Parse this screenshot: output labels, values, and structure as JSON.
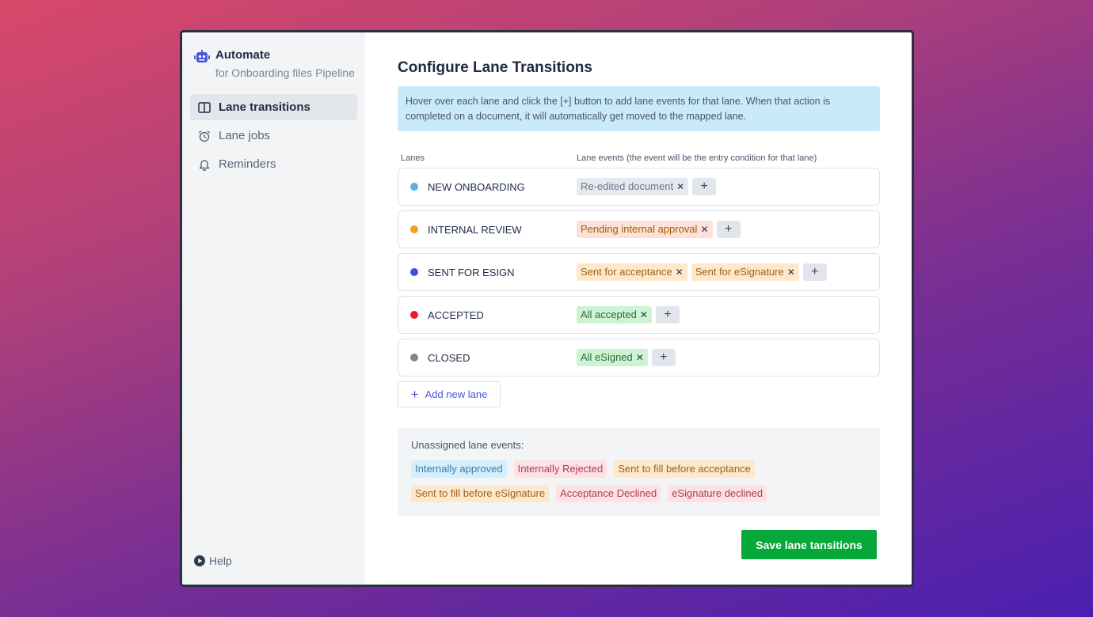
{
  "sidebar": {
    "brand_title": "Automate",
    "brand_subtitle": "for Onboarding files Pipeline",
    "brand_icon": "robot-icon",
    "items": [
      {
        "label": "Lane transitions",
        "icon": "columns-icon",
        "active": true
      },
      {
        "label": "Lane jobs",
        "icon": "alarm-clock-icon",
        "active": false
      },
      {
        "label": "Reminders",
        "icon": "bell-icon",
        "active": false
      }
    ],
    "help_label": "Help",
    "help_icon": "play-circle-icon"
  },
  "main": {
    "title": "Configure Lane Transitions",
    "info": "Hover over each lane and click the [+] button to add lane events for that lane. When that action is completed on a document, it will automatically get moved to the mapped lane.",
    "col_lanes": "Lanes",
    "col_events": "Lane events (the event will be the entry condition for that lane)",
    "lanes": [
      {
        "name": "NEW ONBOARDING",
        "color": "#5aaee8",
        "events": [
          {
            "label": "Re-edited document",
            "bg": "#e6eaf0",
            "fg": "#6b7588"
          }
        ]
      },
      {
        "name": "INTERNAL REVIEW",
        "color": "#f59e1b",
        "events": [
          {
            "label": "Pending internal approval",
            "bg": "#fde0d8",
            "fg": "#a16207"
          }
        ]
      },
      {
        "name": "SENT FOR ESIGN",
        "color": "#3f4fe0",
        "events": [
          {
            "label": "Sent for acceptance",
            "bg": "#fde8cc",
            "fg": "#9a6419"
          },
          {
            "label": "Sent for eSignature",
            "bg": "#fde8cc",
            "fg": "#9a6419"
          }
        ]
      },
      {
        "name": "ACCEPTED",
        "color": "#f0182a",
        "events": [
          {
            "label": "All accepted",
            "bg": "#cdf3d3",
            "fg": "#2f6b3e"
          }
        ]
      },
      {
        "name": "CLOSED",
        "color": "#858585",
        "events": [
          {
            "label": "All eSigned",
            "bg": "#cdf3d3",
            "fg": "#2f6b3e"
          }
        ]
      }
    ],
    "add_lane_label": "Add new lane",
    "unassigned_label": "Unassigned lane events:",
    "unassigned": [
      {
        "label": "Internally approved",
        "bg": "#d3eefc",
        "fg": "#3a7fae"
      },
      {
        "label": "Internally Rejected",
        "bg": "#fde2e4",
        "fg": "#b23a5c"
      },
      {
        "label": "Sent to fill before acceptance",
        "bg": "#fde8cc",
        "fg": "#9a6419"
      },
      {
        "label": "Sent to fill before eSignature",
        "bg": "#fde8cc",
        "fg": "#9a6419"
      },
      {
        "label": "Acceptance Declined",
        "bg": "#fde2e4",
        "fg": "#b23a5c"
      },
      {
        "label": "eSignature declined",
        "bg": "#fde2e4",
        "fg": "#b23a5c"
      }
    ],
    "save_label": "Save lane tansitions",
    "save_color": "#06a83a"
  }
}
